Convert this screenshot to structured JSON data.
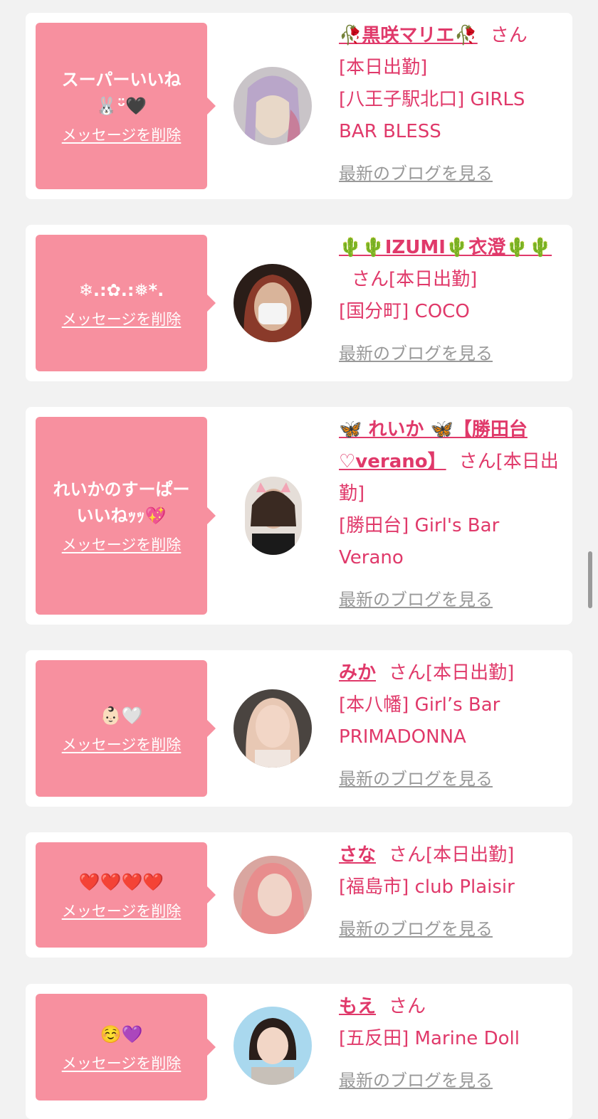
{
  "delete_label": "メッセージを削除",
  "blog_label": "最新のブログを見る",
  "san_label": "さん",
  "cards": [
    {
      "message": "スーパーいいね\n🐰ᵕ̈🖤",
      "name": "🥀黒咲マリエ🥀",
      "status": "[本日出勤]",
      "shop": "[八王子駅北口] GIRLS BAR BLESS"
    },
    {
      "message": "❄︎.:✿.:❅*.",
      "name": "🌵🌵IZUMI🌵衣澄🌵🌵",
      "status": "[本日出勤]",
      "shop": "[国分町] COCO"
    },
    {
      "message": "れいかのすーぱー\nいいねｯｯ💖",
      "name": "🦋 れいか 🦋【勝田台♡verano】",
      "status": "[本日出勤]",
      "shop": "[勝田台] Girl's Bar Verano"
    },
    {
      "message": "👶🏻🤍",
      "name": "みか",
      "status": "[本日出勤]",
      "shop": "[本八幡] Girl’s Bar PRIMADONNA"
    },
    {
      "message": "❤️❤️❤️❤️",
      "name": "さな",
      "status": "[本日出勤]",
      "shop": "[福島市] club Plaisir"
    },
    {
      "message": "☺️💜",
      "name": "もえ",
      "status": "",
      "shop": "[五反田] Marine Doll"
    }
  ]
}
